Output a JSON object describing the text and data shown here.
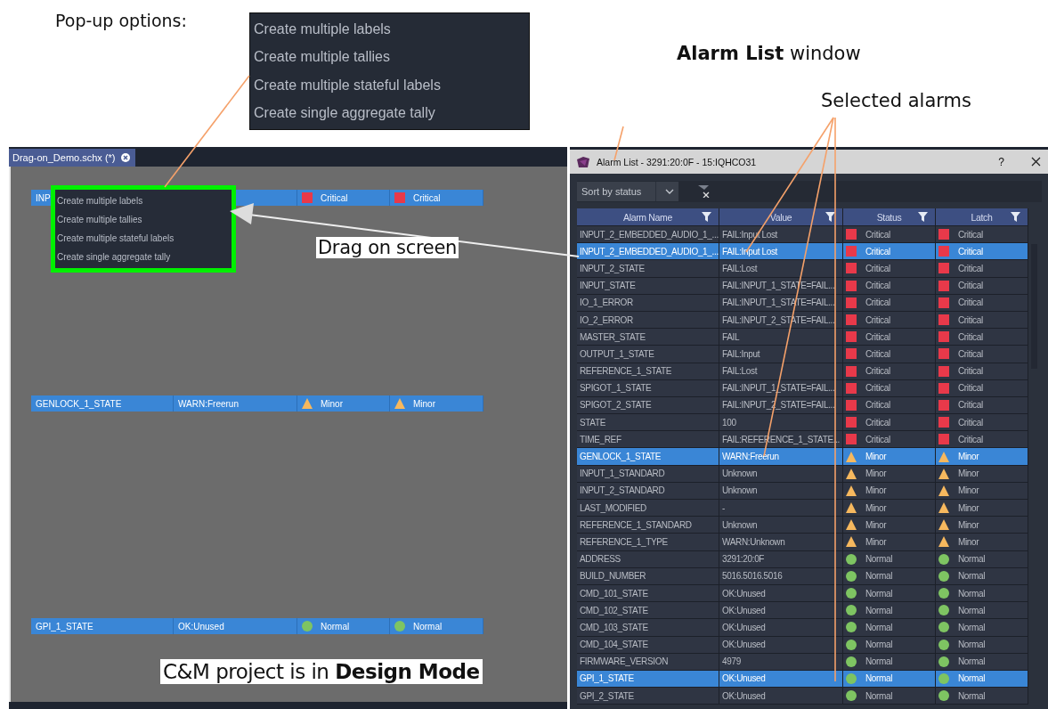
{
  "annotations": {
    "popup_label": "Pop-up options:",
    "window_label": "**Alarm List** window",
    "selected_label": "Selected alarms",
    "drag_label": "Drag on screen",
    "mode_label": "C&M project is in **Design Mode**"
  },
  "popup_zoom": {
    "items": [
      "Create multiple labels",
      "Create multiple tallies",
      "Create multiple stateful labels",
      "Create single aggregate tally"
    ]
  },
  "editor": {
    "tab": {
      "label": "Drag-on_Demo.schx (*)"
    },
    "widgets": [
      {
        "name": "INP",
        "status": "Critical",
        "latch": "Critical",
        "kind": "critical"
      },
      {
        "name": "GENLOCK_1_STATE",
        "value": "WARN:Freerun",
        "status": "Minor",
        "latch": "Minor",
        "kind": "minor"
      },
      {
        "name": "GPI_1_STATE",
        "value": "OK:Unused",
        "status": "Normal",
        "latch": "Normal",
        "kind": "normal"
      }
    ],
    "popup_menu": {
      "items": [
        "Create multiple labels",
        "Create multiple tallies",
        "Create multiple stateful labels",
        "Create single aggregate tally"
      ]
    }
  },
  "alarm_window": {
    "title": "Alarm List - 3291:20:0F - 15:IQHCO31",
    "help": "?",
    "sort": {
      "value": "Sort by status"
    },
    "table": {
      "columns": [
        "Alarm Name",
        "Value",
        "Status",
        "Latch"
      ],
      "rows": [
        {
          "name": "INPUT_2_EMBEDDED_AUDIO_1_...",
          "value": "FAIL:Input Lost",
          "status": "Critical",
          "latch": "Critical",
          "kind": "critical",
          "selected": false
        },
        {
          "name": "INPUT_2_EMBEDDED_AUDIO_1_...",
          "value": "FAIL:Input Lost",
          "status": "Critical",
          "latch": "Critical",
          "kind": "critical",
          "selected": true
        },
        {
          "name": "INPUT_2_STATE",
          "value": "FAIL:Lost",
          "status": "Critical",
          "latch": "Critical",
          "kind": "critical",
          "selected": false
        },
        {
          "name": "INPUT_STATE",
          "value": "FAIL:INPUT_1_STATE=FAIL...",
          "status": "Critical",
          "latch": "Critical",
          "kind": "critical",
          "selected": false
        },
        {
          "name": "IO_1_ERROR",
          "value": "FAIL:INPUT_1_STATE=FAIL...",
          "status": "Critical",
          "latch": "Critical",
          "kind": "critical",
          "selected": false
        },
        {
          "name": "IO_2_ERROR",
          "value": "FAIL:INPUT_2_STATE=FAIL...",
          "status": "Critical",
          "latch": "Critical",
          "kind": "critical",
          "selected": false
        },
        {
          "name": "MASTER_STATE",
          "value": "FAIL",
          "status": "Critical",
          "latch": "Critical",
          "kind": "critical",
          "selected": false
        },
        {
          "name": "OUTPUT_1_STATE",
          "value": "FAIL:Input",
          "status": "Critical",
          "latch": "Critical",
          "kind": "critical",
          "selected": false
        },
        {
          "name": "REFERENCE_1_STATE",
          "value": "FAIL:Lost",
          "status": "Critical",
          "latch": "Critical",
          "kind": "critical",
          "selected": false
        },
        {
          "name": "SPIGOT_1_STATE",
          "value": "FAIL:INPUT_1_STATE=FAIL...",
          "status": "Critical",
          "latch": "Critical",
          "kind": "critical",
          "selected": false
        },
        {
          "name": "SPIGOT_2_STATE",
          "value": "FAIL:INPUT_2_STATE=FAIL...",
          "status": "Critical",
          "latch": "Critical",
          "kind": "critical",
          "selected": false
        },
        {
          "name": "STATE",
          "value": "100",
          "status": "Critical",
          "latch": "Critical",
          "kind": "critical",
          "selected": false
        },
        {
          "name": "TIME_REF",
          "value": "FAIL:REFERENCE_1_STATE...",
          "status": "Critical",
          "latch": "Critical",
          "kind": "critical",
          "selected": false
        },
        {
          "name": "GENLOCK_1_STATE",
          "value": "WARN:Freerun",
          "status": "Minor",
          "latch": "Minor",
          "kind": "minor",
          "selected": true
        },
        {
          "name": "INPUT_1_STANDARD",
          "value": "Unknown",
          "status": "Minor",
          "latch": "Minor",
          "kind": "minor",
          "selected": false
        },
        {
          "name": "INPUT_2_STANDARD",
          "value": "Unknown",
          "status": "Minor",
          "latch": "Minor",
          "kind": "minor",
          "selected": false
        },
        {
          "name": "LAST_MODIFIED",
          "value": "-",
          "status": "Minor",
          "latch": "Minor",
          "kind": "minor",
          "selected": false
        },
        {
          "name": "REFERENCE_1_STANDARD",
          "value": "Unknown",
          "status": "Minor",
          "latch": "Minor",
          "kind": "minor",
          "selected": false
        },
        {
          "name": "REFERENCE_1_TYPE",
          "value": "WARN:Unknown",
          "status": "Minor",
          "latch": "Minor",
          "kind": "minor",
          "selected": false
        },
        {
          "name": "ADDRESS",
          "value": "3291:20:0F",
          "status": "Normal",
          "latch": "Normal",
          "kind": "normal",
          "selected": false
        },
        {
          "name": "BUILD_NUMBER",
          "value": "5016.5016.5016",
          "status": "Normal",
          "latch": "Normal",
          "kind": "normal",
          "selected": false
        },
        {
          "name": "CMD_101_STATE",
          "value": "OK:Unused",
          "status": "Normal",
          "latch": "Normal",
          "kind": "normal",
          "selected": false
        },
        {
          "name": "CMD_102_STATE",
          "value": "OK:Unused",
          "status": "Normal",
          "latch": "Normal",
          "kind": "normal",
          "selected": false
        },
        {
          "name": "CMD_103_STATE",
          "value": "OK:Unused",
          "status": "Normal",
          "latch": "Normal",
          "kind": "normal",
          "selected": false
        },
        {
          "name": "CMD_104_STATE",
          "value": "OK:Unused",
          "status": "Normal",
          "latch": "Normal",
          "kind": "normal",
          "selected": false
        },
        {
          "name": "FIRMWARE_VERSION",
          "value": "4979",
          "status": "Normal",
          "latch": "Normal",
          "kind": "normal",
          "selected": false
        },
        {
          "name": "GPI_1_STATE",
          "value": "OK:Unused",
          "status": "Normal",
          "latch": "Normal",
          "kind": "normal",
          "selected": true
        },
        {
          "name": "GPI_2_STATE",
          "value": "OK:Unused",
          "status": "Normal",
          "latch": "Normal",
          "kind": "normal",
          "selected": false
        }
      ]
    }
  }
}
